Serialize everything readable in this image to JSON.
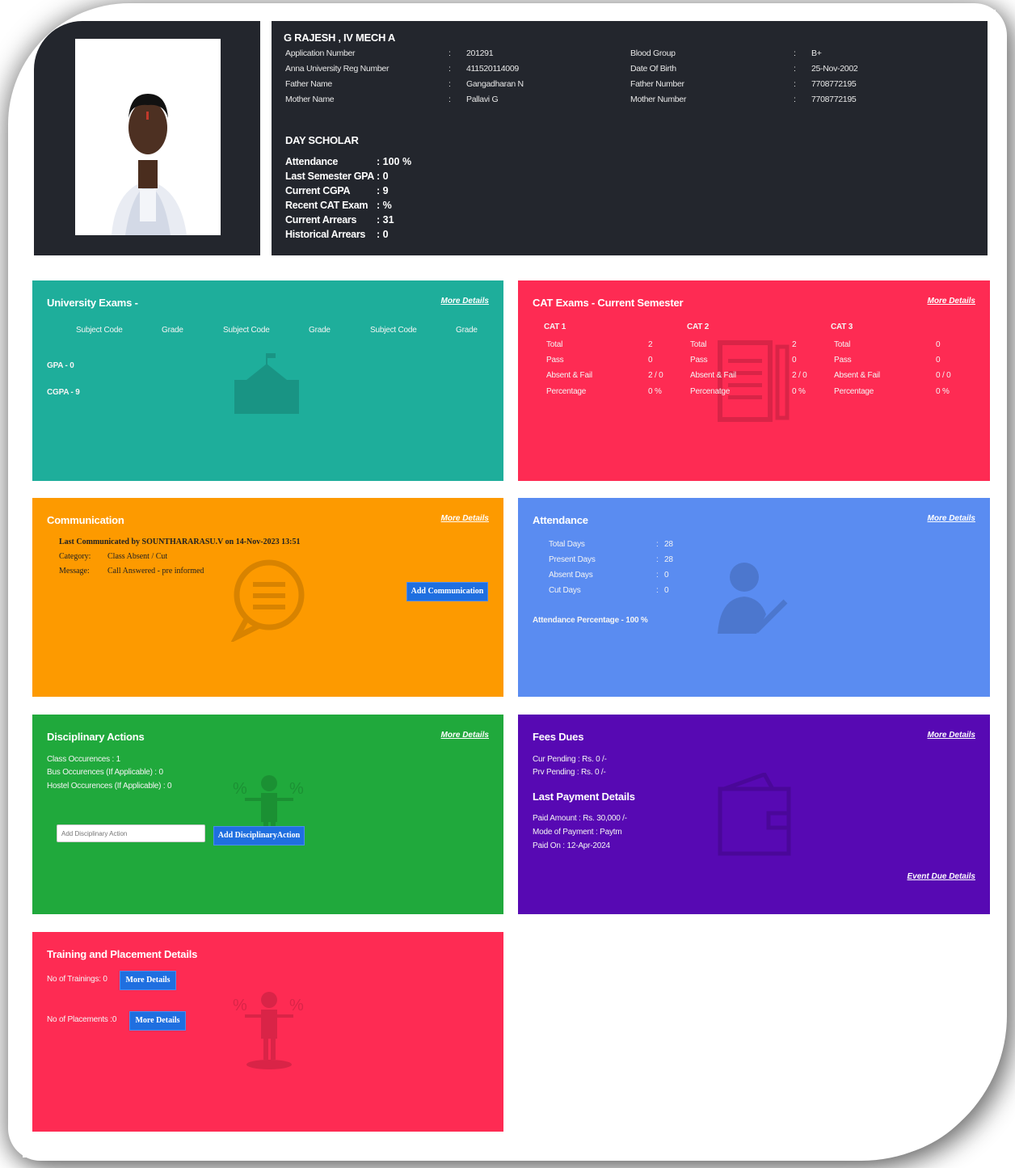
{
  "student": {
    "name": "G RAJESH , IV MECH A",
    "left_fields": [
      {
        "label": "Application Number",
        "value": "201291"
      },
      {
        "label": "Anna University Reg Number",
        "value": "411520114009"
      },
      {
        "label": "Father Name",
        "value": "Gangadharan N"
      },
      {
        "label": "Mother Name",
        "value": "Pallavi G"
      }
    ],
    "right_fields": [
      {
        "label": "Blood Group",
        "value": "B+"
      },
      {
        "label": "Date Of Birth",
        "value": "25-Nov-2002"
      },
      {
        "label": "Father Number",
        "value": "7708772195"
      },
      {
        "label": "Mother Number",
        "value": "7708772195"
      }
    ],
    "separator": ":",
    "type": "DAY SCHOLAR",
    "stats": [
      {
        "label": "Attendance",
        "value": ": 100 %"
      },
      {
        "label": "Last Semester GPA",
        "value": ": 0"
      },
      {
        "label": "Current CGPA",
        "value": ": 9"
      },
      {
        "label": "Recent CAT Exam",
        "value": ": %"
      },
      {
        "label": "Current Arrears",
        "value": ": 31"
      },
      {
        "label": "Historical Arrears",
        "value": ": 0"
      }
    ]
  },
  "common": {
    "more_details": "More Details"
  },
  "university": {
    "title": "University Exams -",
    "headers": [
      "Subject Code",
      "Grade",
      "Subject Code",
      "Grade",
      "Subject Code",
      "Grade"
    ],
    "gpa": "GPA - 0",
    "cgpa": "CGPA - 9"
  },
  "cat": {
    "title": "CAT Exams - Current Semester",
    "exams": [
      {
        "name": "CAT 1",
        "rows": [
          [
            "Total",
            "2"
          ],
          [
            "Pass",
            "0"
          ],
          [
            "Absent & Fail",
            "2 / 0"
          ],
          [
            "Percentage",
            "0 %"
          ]
        ]
      },
      {
        "name": "CAT 2",
        "rows": [
          [
            "Total",
            "2"
          ],
          [
            "Pass",
            "0"
          ],
          [
            "Absent & Fail",
            "2 / 0"
          ],
          [
            "Percenatge",
            "0 %"
          ]
        ]
      },
      {
        "name": "CAT 3",
        "rows": [
          [
            "Total",
            "0"
          ],
          [
            "Pass",
            "0"
          ],
          [
            "Absent & Fail",
            "0 / 0"
          ],
          [
            "Percentage",
            "0 %"
          ]
        ]
      }
    ]
  },
  "communication": {
    "title": "Communication",
    "last": "Last Communicated by SOUNTHARARASU.V on 14-Nov-2023 13:51",
    "category_label": "Category:",
    "category_value": "Class Absent / Cut",
    "message_label": "Message:",
    "message_value": "Call Answered - pre informed",
    "button": "Add Communication"
  },
  "attendance": {
    "title": "Attendance",
    "rows": [
      {
        "label": "Total Days",
        "value": "28"
      },
      {
        "label": "Present Days",
        "value": "28"
      },
      {
        "label": "Absent Days",
        "value": "0"
      },
      {
        "label": "Cut Days",
        "value": "0"
      }
    ],
    "separator": ":",
    "percentage": "Attendance Percentage - 100 %"
  },
  "disciplinary": {
    "title": "Disciplinary Actions",
    "lines": [
      "Class Occurences : 1",
      "Bus Occurences (If Applicable) : 0",
      "Hostel Occurences (If Applicable) : 0"
    ],
    "placeholder": "Add Disciplinary Action",
    "button": "Add DisciplinaryAction"
  },
  "fees": {
    "title": "Fees Dues",
    "cur": "Cur Pending : Rs. 0 /-",
    "prv": "Prv Pending : Rs. 0 /-",
    "last_title": "Last Payment Details",
    "paid": "Paid Amount : Rs. 30,000 /-",
    "mode": "Mode of Payment : Paytm",
    "on": "Paid On : 12-Apr-2024",
    "event_link": "Event Due Details"
  },
  "training": {
    "title": "Training and Placement Details",
    "trainings": "No of Trainings: 0",
    "placements": "No of Placements :0",
    "button": "More Details"
  }
}
